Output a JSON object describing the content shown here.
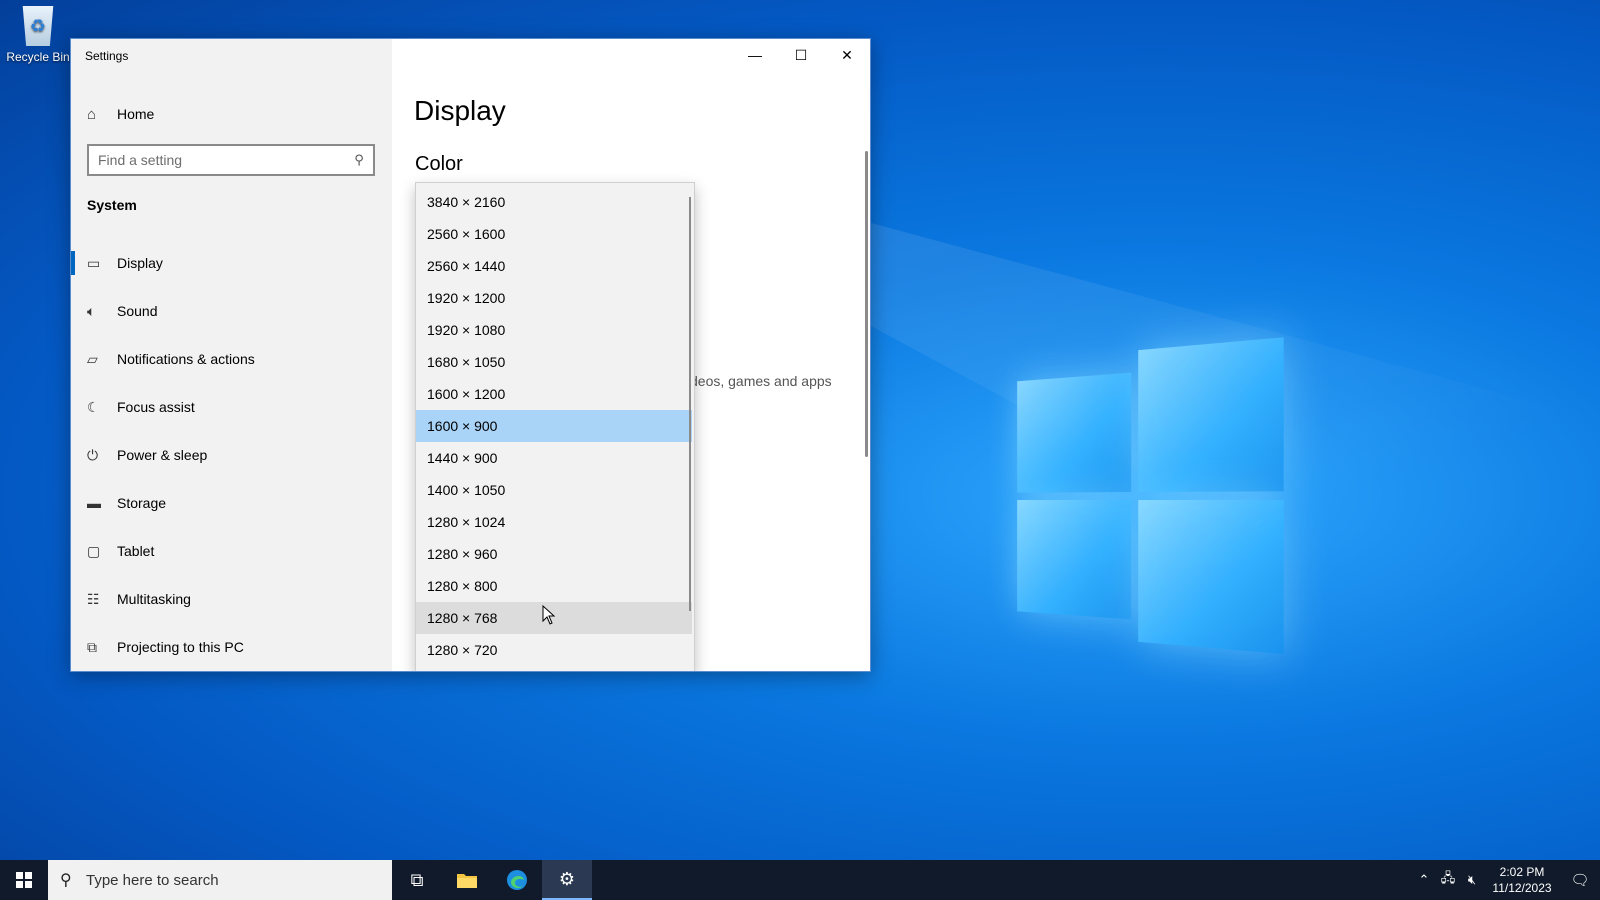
{
  "desktop": {
    "recycle_bin_label": "Recycle Bin"
  },
  "window": {
    "title": "Settings",
    "caption": {
      "minimize": "—",
      "maximize": "☐",
      "close": "✕"
    }
  },
  "sidebar": {
    "home_label": "Home",
    "search_placeholder": "Find a setting",
    "section": "System",
    "items": [
      {
        "label": "Display",
        "icon": "monitor-icon",
        "active": true
      },
      {
        "label": "Sound",
        "icon": "speaker-icon"
      },
      {
        "label": "Notifications & actions",
        "icon": "notification-icon"
      },
      {
        "label": "Focus assist",
        "icon": "moon-icon"
      },
      {
        "label": "Power & sleep",
        "icon": "power-icon"
      },
      {
        "label": "Storage",
        "icon": "drive-icon"
      },
      {
        "label": "Tablet",
        "icon": "tablet-icon"
      },
      {
        "label": "Multitasking",
        "icon": "multitasking-icon"
      },
      {
        "label": "Projecting to this PC",
        "icon": "projector-icon"
      }
    ]
  },
  "main": {
    "page_title": "Display",
    "section_title": "Color",
    "partial_text": "deos, games and apps",
    "partial_mark": ";"
  },
  "resolution_dropdown": {
    "options": [
      "3840 × 2160",
      "2560 × 1600",
      "2560 × 1440",
      "1920 × 1200",
      "1920 × 1080",
      "1680 × 1050",
      "1600 × 1200",
      "1600 × 900",
      "1440 × 900",
      "1400 × 1050",
      "1280 × 1024",
      "1280 × 960",
      "1280 × 800",
      "1280 × 768",
      "1280 × 720"
    ],
    "selected": "1600 × 900",
    "hovered": "1280 × 768",
    "selected_color": "#a9d3f7"
  },
  "taskbar": {
    "search_placeholder": "Type here to search",
    "icons": [
      "task-view-icon",
      "file-explorer-icon",
      "edge-icon",
      "settings-icon"
    ],
    "clock_time": "2:02 PM",
    "clock_date": "11/12/2023"
  },
  "colors": {
    "accent": "#0067c0",
    "taskbar": "#101a2a"
  }
}
